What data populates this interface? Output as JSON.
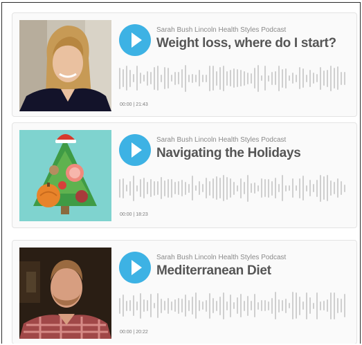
{
  "episodes": [
    {
      "series": "Sarah Bush Lincoln Health Styles Podcast",
      "title": "Weight loss, where do I start?",
      "current": "00:00",
      "separator": "|",
      "duration": "21:43"
    },
    {
      "series": "Sarah Bush Lincoln Health Styles Podcast",
      "title": "Navigating the Holidays",
      "current": "00:00",
      "separator": "|",
      "duration": "18:23"
    },
    {
      "series": "Sarah Bush Lincoln Health Styles Podcast",
      "title": "Mediterranean Diet",
      "current": "00:00",
      "separator": "|",
      "duration": "20:22"
    }
  ],
  "colors": {
    "play_button": "#3db2e4",
    "waveform": "#cfcfcf"
  },
  "icons": {
    "play": "play-icon"
  }
}
